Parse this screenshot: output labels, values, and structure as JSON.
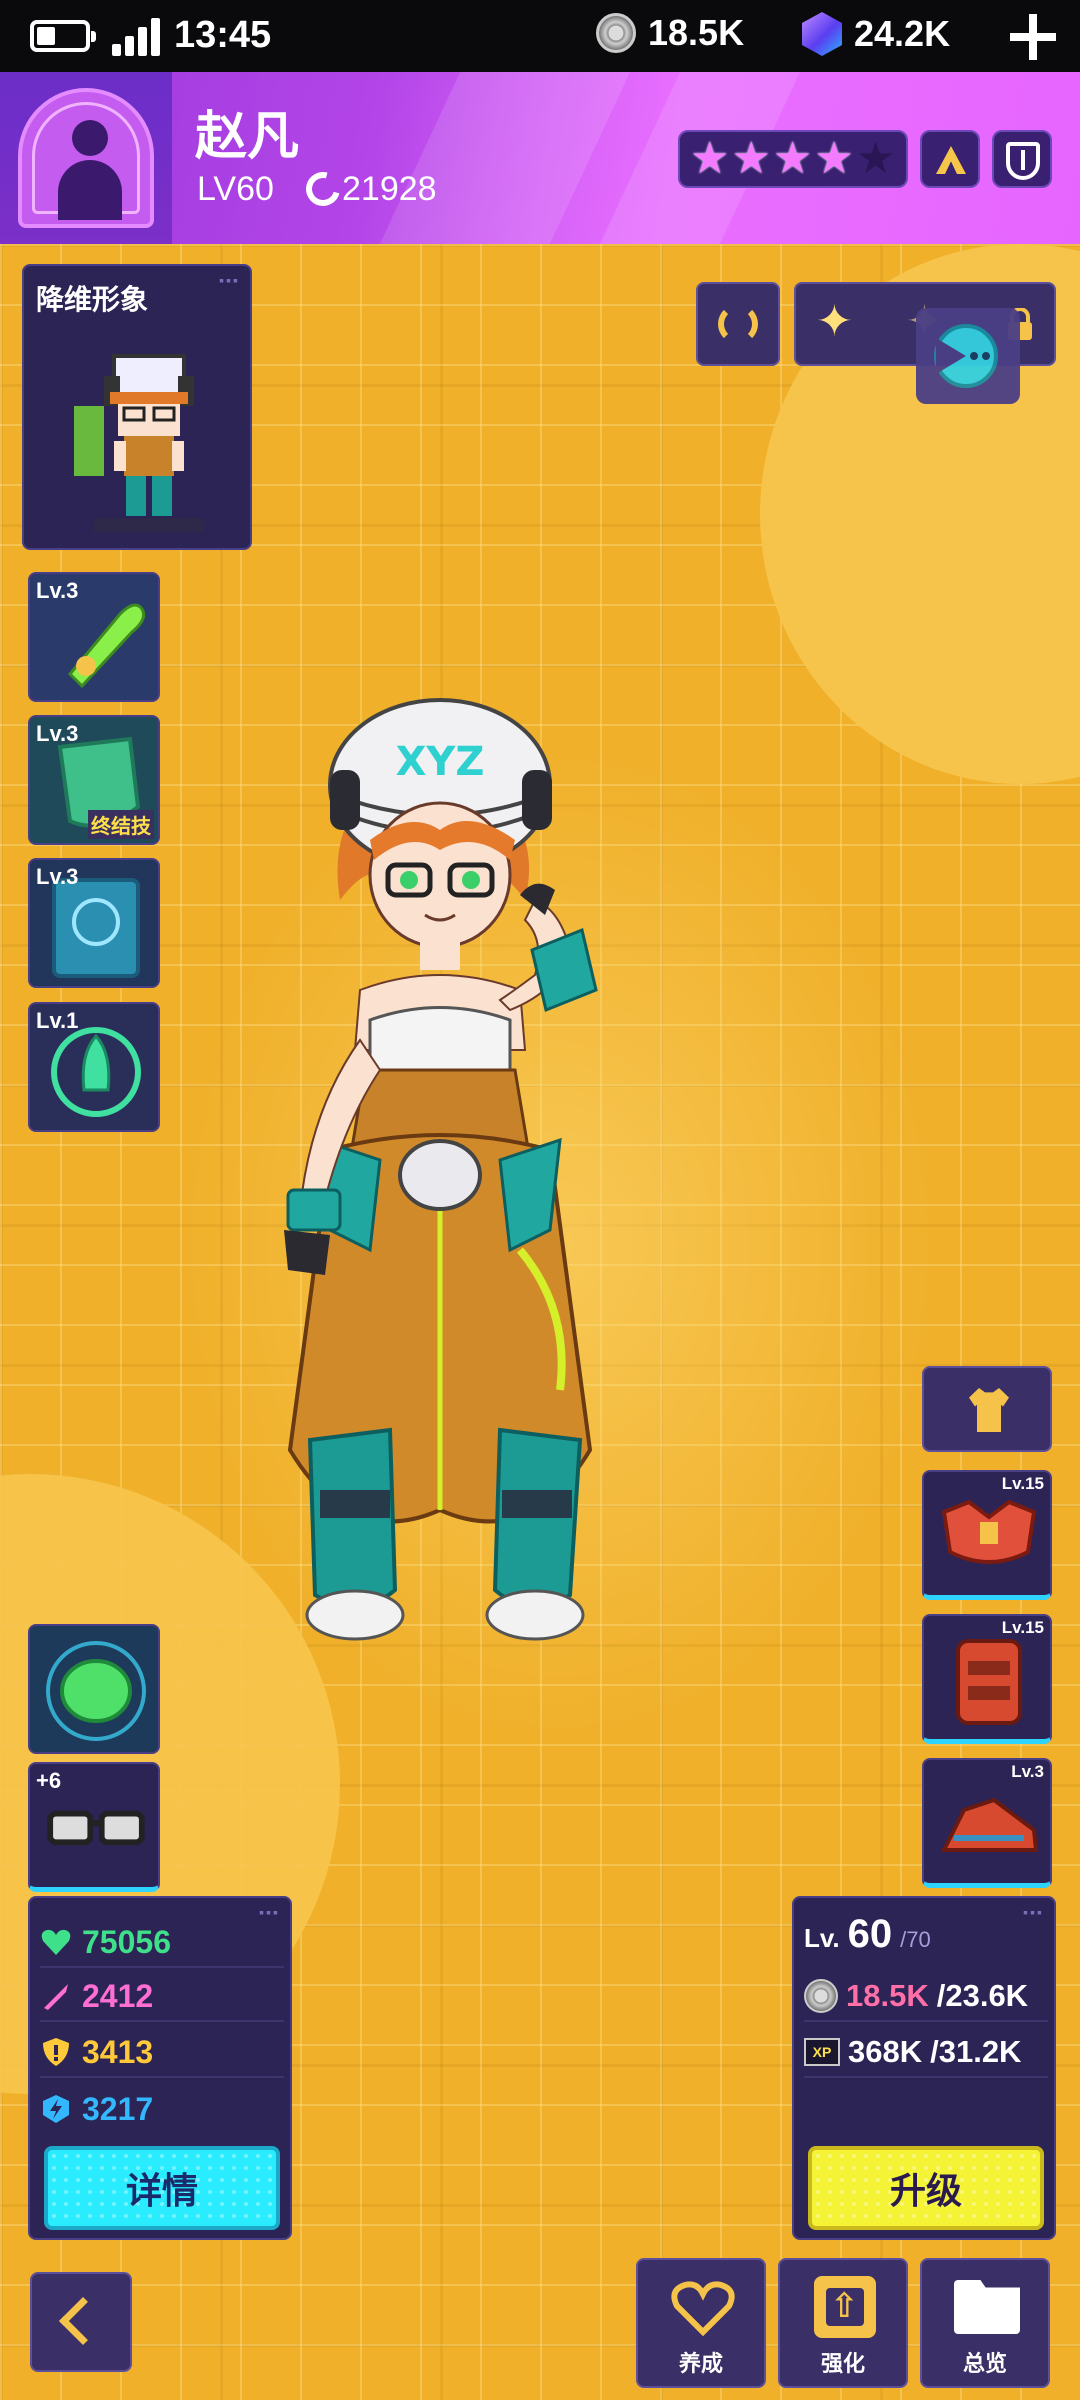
{
  "status_bar": {
    "time": "13:45",
    "coins": "18.5K",
    "gems": "24.2K"
  },
  "header": {
    "player_name": "赵凡",
    "level": "LV60",
    "power": "21928",
    "stars_filled": 4,
    "stars_total": 5
  },
  "pixel_card": {
    "title": "降维形象"
  },
  "skills": [
    {
      "level": "Lv.3",
      "tag": "",
      "icon": "bullet-icon"
    },
    {
      "level": "Lv.3",
      "tag": "终结技",
      "icon": "shield-icon"
    },
    {
      "level": "Lv.3",
      "tag": "",
      "icon": "tablet-icon"
    },
    {
      "level": "Lv.1",
      "tag": "",
      "icon": "rocket-icon"
    }
  ],
  "accessory": {
    "glasses_bonus": "+6"
  },
  "stats": {
    "hp": "75056",
    "attack": "2412",
    "defense": "3413",
    "energy": "3217",
    "details_label": "详情",
    "colors": {
      "hp": "#3fe08a",
      "attack": "#ff6ed2",
      "defense": "#ffc93a",
      "energy": "#33b8ff"
    }
  },
  "equipment": [
    {
      "level": "Lv.15",
      "icon": "armor-icon"
    },
    {
      "level": "Lv.15",
      "icon": "backpack-icon"
    },
    {
      "level": "Lv.3",
      "icon": "shoe-icon"
    }
  ],
  "progress": {
    "lv_label": "Lv.",
    "level": "60",
    "max_level": "/70",
    "coins_have": "18.5K",
    "coins_need": "/23.6K",
    "xp_have": "368K",
    "xp_need": "/31.2K",
    "upgrade_label": "升级"
  },
  "nav": {
    "train": "养成",
    "enhance": "强化",
    "overview": "总览"
  }
}
